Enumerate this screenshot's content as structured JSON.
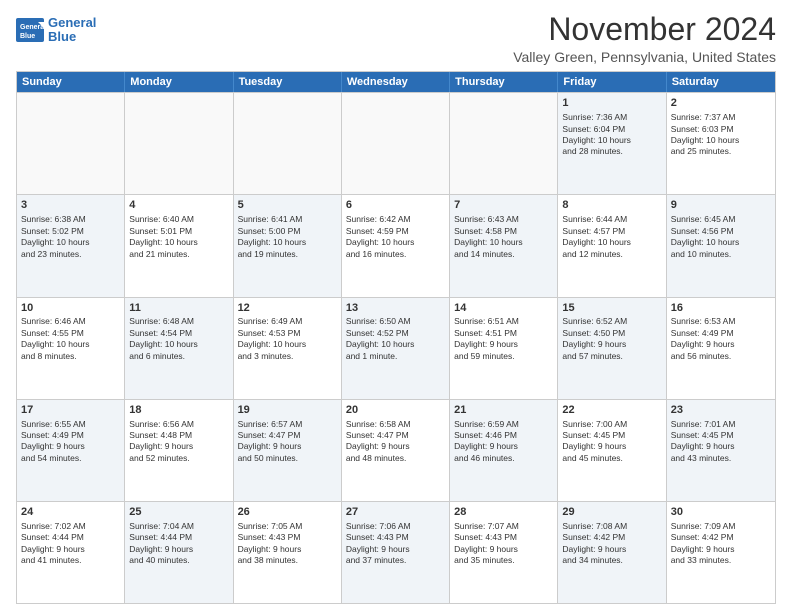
{
  "logo": {
    "line1": "General",
    "line2": "Blue"
  },
  "title": "November 2024",
  "subtitle": "Valley Green, Pennsylvania, United States",
  "header": {
    "days": [
      "Sunday",
      "Monday",
      "Tuesday",
      "Wednesday",
      "Thursday",
      "Friday",
      "Saturday"
    ]
  },
  "rows": [
    [
      {
        "day": "",
        "info": "",
        "empty": true
      },
      {
        "day": "",
        "info": "",
        "empty": true
      },
      {
        "day": "",
        "info": "",
        "empty": true
      },
      {
        "day": "",
        "info": "",
        "empty": true
      },
      {
        "day": "",
        "info": "",
        "empty": true
      },
      {
        "day": "1",
        "info": "Sunrise: 7:36 AM\nSunset: 6:04 PM\nDaylight: 10 hours\nand 28 minutes.",
        "shaded": true
      },
      {
        "day": "2",
        "info": "Sunrise: 7:37 AM\nSunset: 6:03 PM\nDaylight: 10 hours\nand 25 minutes.",
        "shaded": false
      }
    ],
    [
      {
        "day": "3",
        "info": "Sunrise: 6:38 AM\nSunset: 5:02 PM\nDaylight: 10 hours\nand 23 minutes.",
        "shaded": true
      },
      {
        "day": "4",
        "info": "Sunrise: 6:40 AM\nSunset: 5:01 PM\nDaylight: 10 hours\nand 21 minutes.",
        "shaded": false
      },
      {
        "day": "5",
        "info": "Sunrise: 6:41 AM\nSunset: 5:00 PM\nDaylight: 10 hours\nand 19 minutes.",
        "shaded": true
      },
      {
        "day": "6",
        "info": "Sunrise: 6:42 AM\nSunset: 4:59 PM\nDaylight: 10 hours\nand 16 minutes.",
        "shaded": false
      },
      {
        "day": "7",
        "info": "Sunrise: 6:43 AM\nSunset: 4:58 PM\nDaylight: 10 hours\nand 14 minutes.",
        "shaded": true
      },
      {
        "day": "8",
        "info": "Sunrise: 6:44 AM\nSunset: 4:57 PM\nDaylight: 10 hours\nand 12 minutes.",
        "shaded": false
      },
      {
        "day": "9",
        "info": "Sunrise: 6:45 AM\nSunset: 4:56 PM\nDaylight: 10 hours\nand 10 minutes.",
        "shaded": true
      }
    ],
    [
      {
        "day": "10",
        "info": "Sunrise: 6:46 AM\nSunset: 4:55 PM\nDaylight: 10 hours\nand 8 minutes.",
        "shaded": false
      },
      {
        "day": "11",
        "info": "Sunrise: 6:48 AM\nSunset: 4:54 PM\nDaylight: 10 hours\nand 6 minutes.",
        "shaded": true
      },
      {
        "day": "12",
        "info": "Sunrise: 6:49 AM\nSunset: 4:53 PM\nDaylight: 10 hours\nand 3 minutes.",
        "shaded": false
      },
      {
        "day": "13",
        "info": "Sunrise: 6:50 AM\nSunset: 4:52 PM\nDaylight: 10 hours\nand 1 minute.",
        "shaded": true
      },
      {
        "day": "14",
        "info": "Sunrise: 6:51 AM\nSunset: 4:51 PM\nDaylight: 9 hours\nand 59 minutes.",
        "shaded": false
      },
      {
        "day": "15",
        "info": "Sunrise: 6:52 AM\nSunset: 4:50 PM\nDaylight: 9 hours\nand 57 minutes.",
        "shaded": true
      },
      {
        "day": "16",
        "info": "Sunrise: 6:53 AM\nSunset: 4:49 PM\nDaylight: 9 hours\nand 56 minutes.",
        "shaded": false
      }
    ],
    [
      {
        "day": "17",
        "info": "Sunrise: 6:55 AM\nSunset: 4:49 PM\nDaylight: 9 hours\nand 54 minutes.",
        "shaded": true
      },
      {
        "day": "18",
        "info": "Sunrise: 6:56 AM\nSunset: 4:48 PM\nDaylight: 9 hours\nand 52 minutes.",
        "shaded": false
      },
      {
        "day": "19",
        "info": "Sunrise: 6:57 AM\nSunset: 4:47 PM\nDaylight: 9 hours\nand 50 minutes.",
        "shaded": true
      },
      {
        "day": "20",
        "info": "Sunrise: 6:58 AM\nSunset: 4:47 PM\nDaylight: 9 hours\nand 48 minutes.",
        "shaded": false
      },
      {
        "day": "21",
        "info": "Sunrise: 6:59 AM\nSunset: 4:46 PM\nDaylight: 9 hours\nand 46 minutes.",
        "shaded": true
      },
      {
        "day": "22",
        "info": "Sunrise: 7:00 AM\nSunset: 4:45 PM\nDaylight: 9 hours\nand 45 minutes.",
        "shaded": false
      },
      {
        "day": "23",
        "info": "Sunrise: 7:01 AM\nSunset: 4:45 PM\nDaylight: 9 hours\nand 43 minutes.",
        "shaded": true
      }
    ],
    [
      {
        "day": "24",
        "info": "Sunrise: 7:02 AM\nSunset: 4:44 PM\nDaylight: 9 hours\nand 41 minutes.",
        "shaded": false
      },
      {
        "day": "25",
        "info": "Sunrise: 7:04 AM\nSunset: 4:44 PM\nDaylight: 9 hours\nand 40 minutes.",
        "shaded": true
      },
      {
        "day": "26",
        "info": "Sunrise: 7:05 AM\nSunset: 4:43 PM\nDaylight: 9 hours\nand 38 minutes.",
        "shaded": false
      },
      {
        "day": "27",
        "info": "Sunrise: 7:06 AM\nSunset: 4:43 PM\nDaylight: 9 hours\nand 37 minutes.",
        "shaded": true
      },
      {
        "day": "28",
        "info": "Sunrise: 7:07 AM\nSunset: 4:43 PM\nDaylight: 9 hours\nand 35 minutes.",
        "shaded": false
      },
      {
        "day": "29",
        "info": "Sunrise: 7:08 AM\nSunset: 4:42 PM\nDaylight: 9 hours\nand 34 minutes.",
        "shaded": true
      },
      {
        "day": "30",
        "info": "Sunrise: 7:09 AM\nSunset: 4:42 PM\nDaylight: 9 hours\nand 33 minutes.",
        "shaded": false
      }
    ]
  ]
}
